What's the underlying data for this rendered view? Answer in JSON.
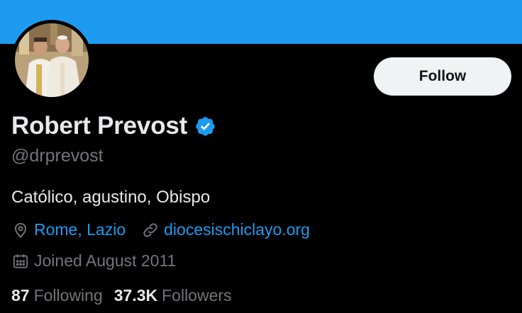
{
  "colors": {
    "banner": "#1d9bf0",
    "background": "#000000",
    "primary_text": "#e7e9ea",
    "secondary_text": "#71767b",
    "link": "#1d9bf0",
    "verified_badge": "#1d9bf0",
    "follow_button_bg": "#eff3f4",
    "follow_button_text": "#0f1419"
  },
  "profile": {
    "display_name": "Robert Prevost",
    "handle": "@drprevost",
    "verified_icon": "verified-check-icon",
    "follow_label": "Follow",
    "bio": "Católico, agustino, Obispo",
    "location": {
      "icon": "location-pin-icon",
      "text": "Rome, Lazio"
    },
    "website": {
      "icon": "link-icon",
      "text": "diocesischiclayo.org"
    },
    "joined": {
      "icon": "calendar-icon",
      "text": "Joined August 2011"
    },
    "stats": {
      "following_count": "87",
      "following_label": "Following",
      "followers_count": "37.3K",
      "followers_label": "Followers"
    }
  }
}
